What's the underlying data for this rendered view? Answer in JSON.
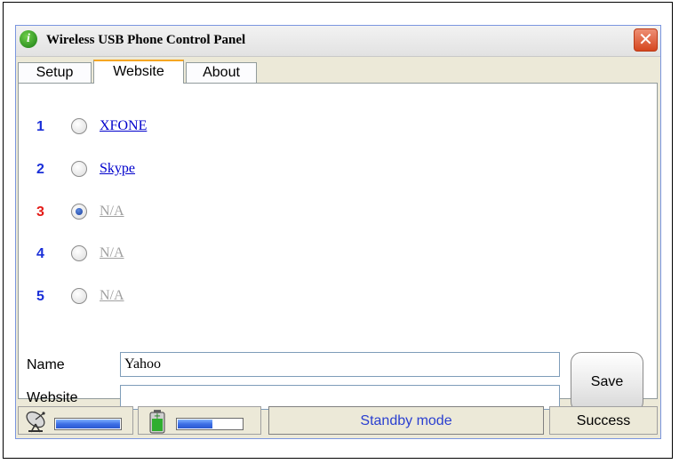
{
  "window": {
    "title": "Wireless USB Phone Control Panel",
    "title_icon_glyph": "i",
    "close_glyph": "✕"
  },
  "tabs": [
    {
      "label": "Setup",
      "active": false
    },
    {
      "label": "Website",
      "active": true
    },
    {
      "label": "About",
      "active": false
    }
  ],
  "websites": [
    {
      "number": "1",
      "label": "XFONE",
      "checked": false,
      "enabled": true,
      "number_color": "#1a2fd8"
    },
    {
      "number": "2",
      "label": "Skype",
      "checked": false,
      "enabled": true,
      "number_color": "#1a2fd8"
    },
    {
      "number": "3",
      "label": "N/A",
      "checked": true,
      "enabled": false,
      "number_color": "#e41b17"
    },
    {
      "number": "4",
      "label": "N/A",
      "checked": false,
      "enabled": false,
      "number_color": "#1a2fd8"
    },
    {
      "number": "5",
      "label": "N/A",
      "checked": false,
      "enabled": false,
      "number_color": "#1a2fd8"
    }
  ],
  "form": {
    "name_label": "Name",
    "name_value": "Yahoo",
    "website_label": "Website",
    "website_value": "",
    "save_label": "Save"
  },
  "status": {
    "signal_icon": "satellite-dish-icon",
    "signal_level": 1.0,
    "battery_icon": "battery-icon",
    "battery_level": 0.55,
    "mode_text": "Standby mode",
    "result_text": "Success"
  },
  "colors": {
    "mode_text": "#2a3fd0",
    "link": "#0000cc",
    "disabled": "#a0a0a0"
  }
}
